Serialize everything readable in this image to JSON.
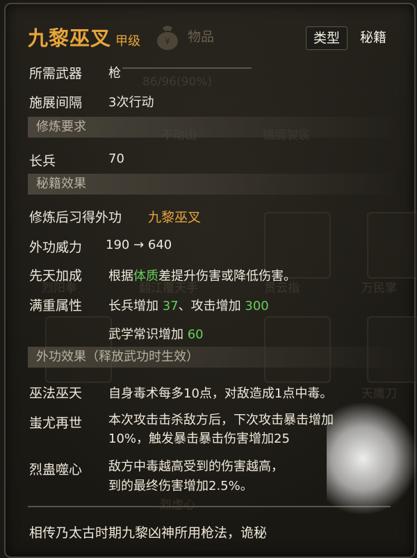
{
  "header": {
    "title": "九黎巫叉",
    "grade": "甲级",
    "items_label": "物品",
    "type_tag": "类型",
    "kind_tag": "秘籍"
  },
  "background": {
    "progress_text": "86/96(90%)",
    "skill_names": [
      "不动山",
      "锦绸袈裟",
      "烈阳拳",
      "翻江覆天手",
      "贯云指",
      "万民掌",
      "烈虚心",
      "天鹰刀"
    ]
  },
  "stats": {
    "weapon_label": "所需武器",
    "weapon_value": "枪",
    "interval_label": "施展间隔",
    "interval_value": "3次行动"
  },
  "requirements": {
    "section_title": "修炼要求",
    "req_label": "长兵",
    "req_value": "70"
  },
  "effects": {
    "section_title": "秘籍效果",
    "learn_label": "修炼后习得外功",
    "learn_value": "九黎巫叉",
    "power_label": "外功威力",
    "power_value": "190 → 640",
    "innate_label": "先天加成",
    "innate_pre": "根据",
    "innate_highlight": "体质",
    "innate_post": "差提升伤害或降低伤害。",
    "full_label": "满重属性",
    "full_a_pre": "长兵增加 ",
    "full_a_val": "37",
    "full_b_pre": "、攻击增加 ",
    "full_b_val": "300",
    "full_c_pre": "武学常识增加 ",
    "full_c_val": "60"
  },
  "external": {
    "section_title": "外功效果（释放武功时生效）",
    "e1_label": "巫法巫天",
    "e1_text": "自身毒术每多10点，对敌造成1点中毒。",
    "e2_label": "蚩尤再世",
    "e2_line1": "本次攻击击杀敌方后，下次攻击暴击增加",
    "e2_line2": "10%，触发暴击暴击伤害增加25",
    "e3_label": "烈蛊噬心",
    "e3_line1": "敌方中毒越高受到的伤害越高，",
    "e3_line2": "到的最终伤害增加2.5%。"
  },
  "footer": {
    "lore": "相传乃太古时期九黎凶神所用枪法，诡秘"
  },
  "colors": {
    "gold": "#e7a53b",
    "green": "#68cf5b",
    "text": "#efe9dc"
  }
}
